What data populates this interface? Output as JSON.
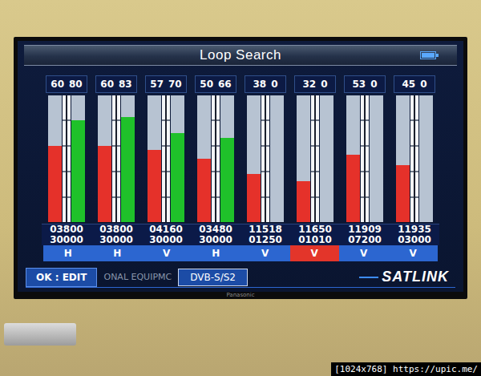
{
  "tv": {
    "brand": "Panasonic"
  },
  "screen": {
    "title": "Loop Search",
    "battery_level": 1
  },
  "channels": [
    {
      "strength": "60",
      "quality": "80",
      "strength_level": 0.6,
      "quality_level": 0.8,
      "frequency": "03800",
      "symbol_rate": "30000",
      "polarization": "H",
      "selected": false
    },
    {
      "strength": "60",
      "quality": "83",
      "strength_level": 0.6,
      "quality_level": 0.83,
      "frequency": "03800",
      "symbol_rate": "30000",
      "polarization": "H",
      "selected": false
    },
    {
      "strength": "57",
      "quality": "70",
      "strength_level": 0.57,
      "quality_level": 0.7,
      "frequency": "04160",
      "symbol_rate": "30000",
      "polarization": "V",
      "selected": false
    },
    {
      "strength": "50",
      "quality": "66",
      "strength_level": 0.5,
      "quality_level": 0.66,
      "frequency": "03480",
      "symbol_rate": "30000",
      "polarization": "H",
      "selected": false
    },
    {
      "strength": "38",
      "quality": "0",
      "strength_level": 0.38,
      "quality_level": 0,
      "frequency": "11518",
      "symbol_rate": "01250",
      "polarization": "V",
      "selected": false
    },
    {
      "strength": "32",
      "quality": "0",
      "strength_level": 0.32,
      "quality_level": 0,
      "frequency": "11650",
      "symbol_rate": "01010",
      "polarization": "V",
      "selected": true
    },
    {
      "strength": "53",
      "quality": "0",
      "strength_level": 0.53,
      "quality_level": 0,
      "frequency": "11909",
      "symbol_rate": "07200",
      "polarization": "V",
      "selected": false
    },
    {
      "strength": "45",
      "quality": "0",
      "strength_level": 0.45,
      "quality_level": 0,
      "frequency": "11935",
      "symbol_rate": "03000",
      "polarization": "V",
      "selected": false
    }
  ],
  "footer": {
    "ok_hint": "OK : EDIT",
    "background_text": "ONAL EQUIPMC",
    "standard": "DVB-S/S2",
    "logo": "SATLINK"
  },
  "watermark": "[1024x768] https://upic.me/"
}
